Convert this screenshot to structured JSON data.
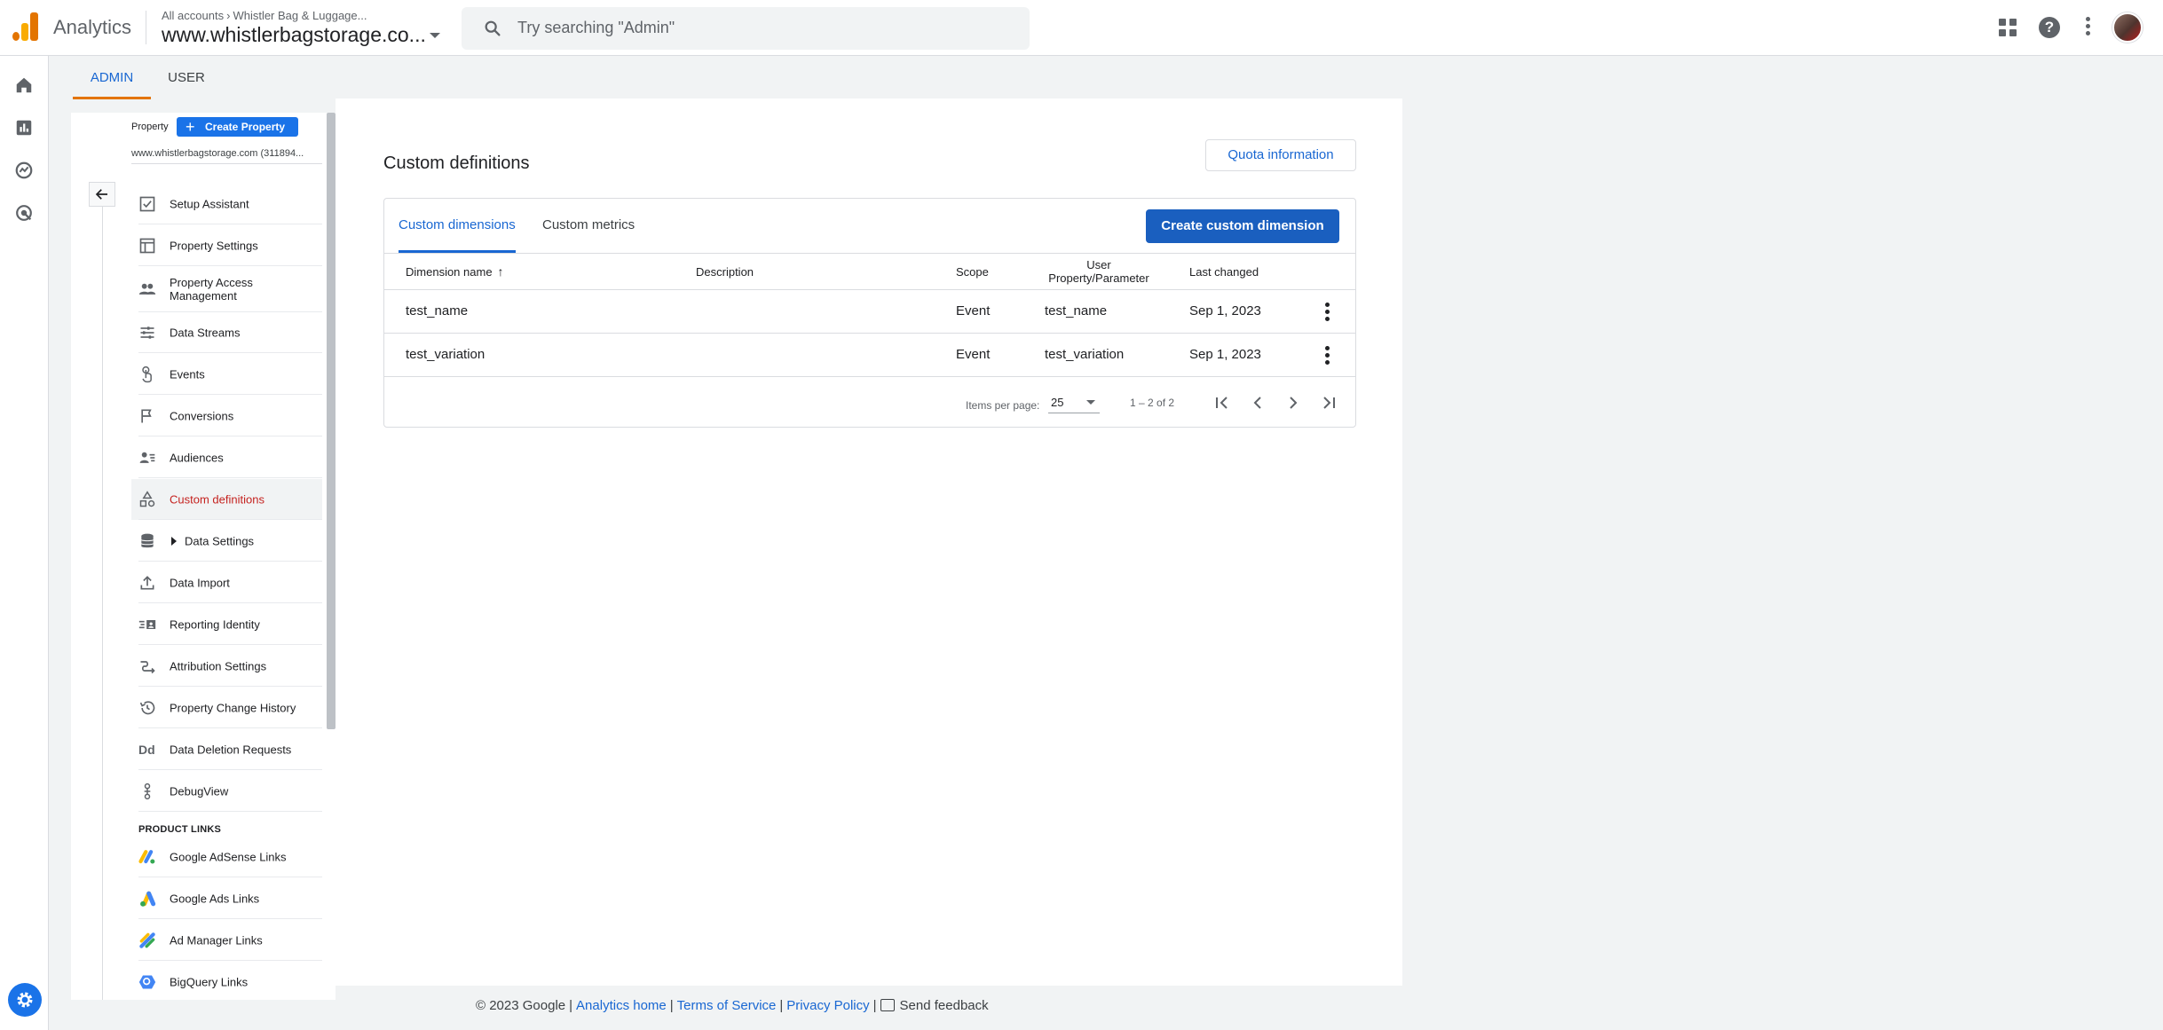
{
  "app": {
    "name": "Analytics",
    "breadcrumb": [
      "All accounts",
      "Whistler Bag & Luggage..."
    ],
    "account_title": "www.whistlerbagstorage.co...",
    "search_placeholder": "Try searching \"Admin\""
  },
  "top_tabs": [
    {
      "label": "ADMIN",
      "active": true
    },
    {
      "label": "USER",
      "active": false
    }
  ],
  "admin_panel": {
    "property_label": "Property",
    "create_property_label": "Create Property",
    "property_name": "www.whistlerbagstorage.com (311894...",
    "items": [
      {
        "label": "Setup Assistant",
        "icon": "checkbox-icon"
      },
      {
        "label": "Property Settings",
        "icon": "layout-icon"
      },
      {
        "label": "Property Access Management",
        "icon": "people-icon"
      },
      {
        "label": "Data Streams",
        "icon": "streams-icon"
      },
      {
        "label": "Events",
        "icon": "touch-icon"
      },
      {
        "label": "Conversions",
        "icon": "flag-icon"
      },
      {
        "label": "Audiences",
        "icon": "audience-icon"
      },
      {
        "label": "Custom definitions",
        "icon": "shapes-icon",
        "active": true
      },
      {
        "label": "Data Settings",
        "icon": "database-icon"
      },
      {
        "label": "Data Import",
        "icon": "upload-icon"
      },
      {
        "label": "Reporting Identity",
        "icon": "identity-icon"
      },
      {
        "label": "Attribution Settings",
        "icon": "attribution-icon"
      },
      {
        "label": "Property Change History",
        "icon": "history-icon"
      },
      {
        "label": "Data Deletion Requests",
        "icon": "dd-icon"
      },
      {
        "label": "DebugView",
        "icon": "debug-icon"
      }
    ],
    "product_links_heading": "PRODUCT LINKS",
    "product_links": [
      {
        "label": "Google AdSense Links",
        "icon": "adsense-icon"
      },
      {
        "label": "Google Ads Links",
        "icon": "google-ads-icon"
      },
      {
        "label": "Ad Manager Links",
        "icon": "ad-manager-icon"
      },
      {
        "label": "BigQuery Links",
        "icon": "bigquery-icon"
      }
    ]
  },
  "main": {
    "title": "Custom definitions",
    "quota_button": "Quota information",
    "tabs": [
      {
        "label": "Custom dimensions",
        "active": true
      },
      {
        "label": "Custom metrics",
        "active": false
      }
    ],
    "create_button": "Create custom dimension",
    "columns": {
      "name": "Dimension name",
      "description": "Description",
      "scope": "Scope",
      "user_property": "User Property/Parameter",
      "last_changed": "Last changed"
    },
    "rows": [
      {
        "name": "test_name",
        "description": "",
        "scope": "Event",
        "user_property": "test_name",
        "last_changed": "Sep 1, 2023"
      },
      {
        "name": "test_variation",
        "description": "",
        "scope": "Event",
        "user_property": "test_variation",
        "last_changed": "Sep 1, 2023"
      }
    ],
    "pagination": {
      "items_per_page_label": "Items per page:",
      "items_per_page": "25",
      "range": "1 – 2 of 2"
    }
  },
  "footer": {
    "copyright": "© 2023 Google",
    "links": [
      "Analytics home",
      "Terms of Service",
      "Privacy Policy"
    ],
    "feedback": "Send feedback"
  },
  "colors": {
    "accent_blue": "#1a73e8",
    "primary_button": "#1a5fbf",
    "active_nav_text": "#c5221f",
    "tab_indicator": "#e37400"
  }
}
